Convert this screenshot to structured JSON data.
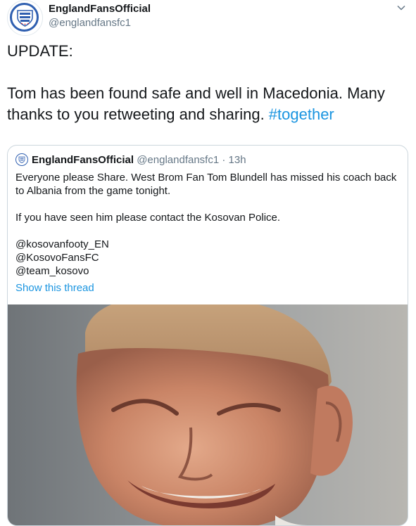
{
  "tweet": {
    "author": {
      "display_name": "EnglandFansOfficial",
      "handle": "@englandfansfc1",
      "avatar_icon": "england-crest-icon"
    },
    "caret_icon": "chevron-down-icon",
    "text": {
      "line1": "UPDATE:",
      "line2": "Tom has been found safe and well in Macedonia. Many thanks to you retweeting and sharing. ",
      "hashtag": "#together"
    }
  },
  "quote": {
    "author": {
      "display_name": "EnglandFansOfficial",
      "meta": "@englandfansfc1 · 13h"
    },
    "body": {
      "p1": "Everyone please Share. West Brom Fan Tom Blundell has missed his coach back to Albania from the game tonight.",
      "p2": "If you have seen him please contact the Kosovan Police.",
      "mention1": "@kosovanfooty_EN",
      "mention2": "@KosovoFansFC",
      "mention3": "@team_kosovo"
    },
    "show_thread": "Show this thread",
    "photo_subject": "photo of smiling young man"
  },
  "colors": {
    "link": "#1b95e0",
    "secondary_text": "#657786",
    "border": "#ccd6dd",
    "crest_blue": "#2f5fb0",
    "crest_red": "#d6202a"
  }
}
